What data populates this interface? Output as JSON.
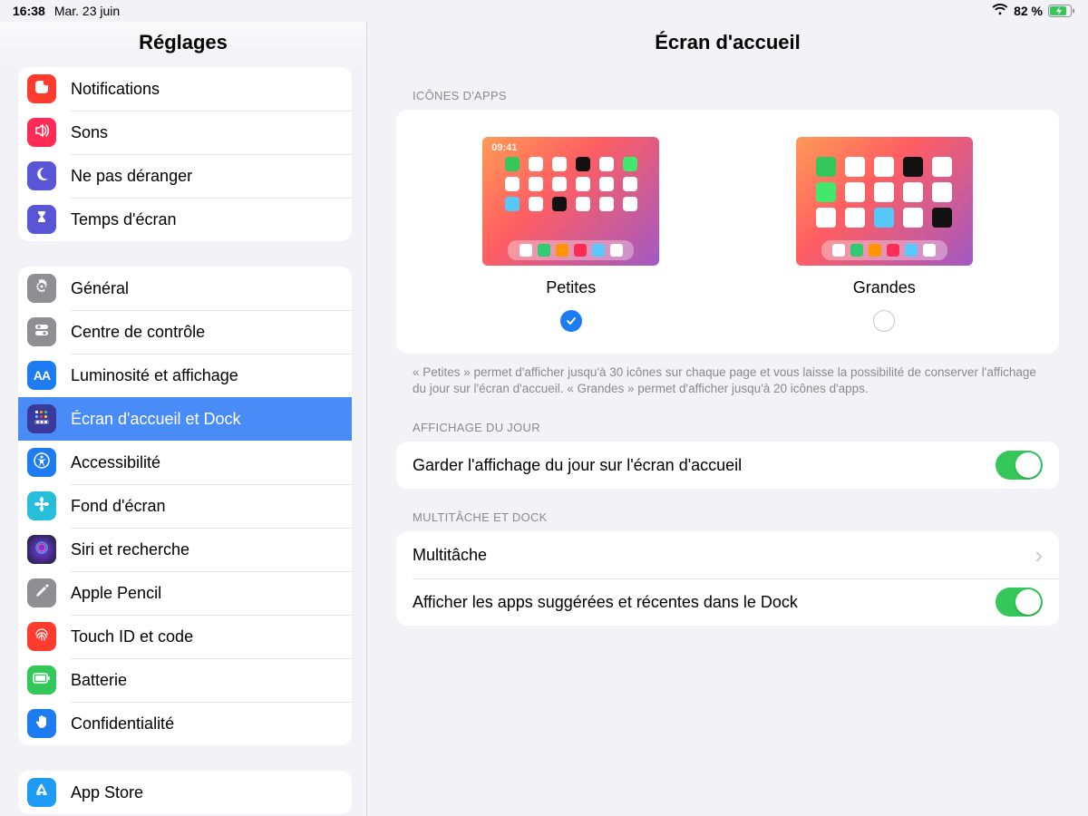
{
  "status": {
    "time": "16:38",
    "date": "Mar. 23 juin",
    "battery": "82 %"
  },
  "sidebar": {
    "title": "Réglages",
    "g1": {
      "notifications": "Notifications",
      "sounds": "Sons",
      "dnd": "Ne pas déranger",
      "screentime": "Temps d'écran"
    },
    "g2": {
      "general": "Général",
      "control": "Centre de contrôle",
      "display": "Luminosité et affichage",
      "home": "Écran d'accueil et Dock",
      "accessibility": "Accessibilité",
      "wallpaper": "Fond d'écran",
      "siri": "Siri et recherche",
      "pencil": "Apple Pencil",
      "touchid": "Touch ID et code",
      "battery": "Batterie",
      "privacy": "Confidentialité"
    },
    "g3": {
      "appstore": "App Store"
    }
  },
  "detail": {
    "title": "Écran d'accueil",
    "icons_header": "ICÔNES D'APPS",
    "small_label": "Petites",
    "large_label": "Grandes",
    "preview_clock": "09:41",
    "note": "« Petites » permet d'afficher jusqu'à 30 icônes sur chaque page et vous laisse la possibilité de conserver l'affichage du jour sur l'écran d'accueil. « Grandes » permet d'afficher jusqu'à 20 icônes d'apps.",
    "todayview_header": "AFFICHAGE DU JOUR",
    "todayview_row": "Garder l'affichage du jour sur l'écran d'accueil",
    "multi_header": "MULTITÂCHE ET DOCK",
    "multitasking": "Multitâche",
    "suggested": "Afficher les apps suggérées et récentes dans le Dock"
  }
}
